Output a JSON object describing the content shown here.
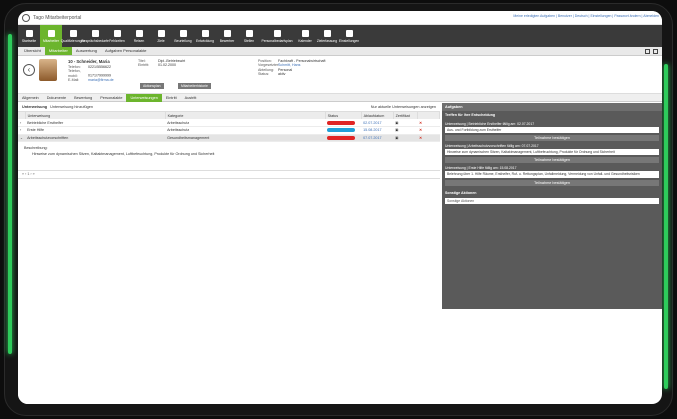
{
  "app": {
    "title": "Tago Mitarbeiterportal"
  },
  "topright": "Meine erledigten Aufgaben | Benutzer | Deutsch | Einstellungen | Passwort ändern | Abmelden",
  "nav": [
    "Startseite",
    "Mitarbeiter",
    "Qualifizierungen",
    "Gesprächsbedarfe",
    "Fehlzeiten",
    "Reisen",
    "Ziele",
    "Beurteilung",
    "Entwicklung",
    "Bewerber",
    "Stellen",
    "Personalbedarfsplan",
    "Kalender",
    "Zielerfassung",
    "Einstellungen"
  ],
  "tabs": [
    "Übersicht",
    "Mitarbeiter",
    "Auswertung",
    "Aufgaben Personalakte"
  ],
  "employee": {
    "name": "10 - Schneider, Maria",
    "col1": [
      [
        "Telefon:",
        "0221/5556622"
      ],
      [
        "Telefon, mobil:",
        "0171/7999999"
      ],
      [
        "E-Mail:",
        "maria@firma.de"
      ]
    ],
    "col2": [
      [
        "Titel:",
        "Dipl.-Betriebswirt"
      ],
      [
        "Eintritt:",
        "01.02.2000"
      ]
    ],
    "col3": [
      [
        "Position:",
        "Fachkraft - Personalwirtschaft"
      ],
      [
        "Vorgesetzter:",
        "Schmitt, Hans"
      ],
      [
        "Abteilung:",
        "Personal"
      ],
      [
        "Status:",
        "aktiv"
      ]
    ],
    "btn1": "Aktionsplan",
    "btn2": "Mitarbeiterhistorie"
  },
  "subtabs": [
    "Allgemein",
    "Dokumente",
    "Bewertung",
    "Personalakte",
    "Unterweisungen",
    "Eintritt",
    "Austritt"
  ],
  "toolbar": {
    "label": "Unterweisung",
    "add": "Unterweisung hinzufügen",
    "checkbox": "Nur aktuelle Unterweisungen anzeigen"
  },
  "columns": [
    "Unterweisung",
    "Kategorie",
    "Status",
    "Ablaufdatum",
    "Zertifikat"
  ],
  "rows": [
    {
      "name": "Betriebliche Ersthelfer",
      "cat": "Arbeitsschutz",
      "color": "#e02424",
      "date": "02.07.2017"
    },
    {
      "name": "Erste Hilfe",
      "cat": "Arbeitsschutz",
      "color": "#1fa0d8",
      "date": "15.08.2017"
    },
    {
      "name": "Arbeitsschutzvorschriften",
      "cat": "Gesundheitsmanagement",
      "color": "#e02424",
      "date": "07.07.2017"
    }
  ],
  "desc": {
    "label": "Beschreibung:",
    "text": "Hinweise zum dynamischen Sitzen, Kaltaktmanagement, Luftbefeuchtung, Produkte für Ordnung und Sicherheit"
  },
  "pager": "«  ‹  1  ›  »",
  "panel": {
    "title": "Aufgaben",
    "section": "Treffen für Ihre Entscheidung",
    "tasks": [
      {
        "h": "Unterweisung | Betriebliche Ersthelfer fällig am: 02.07.2017",
        "box": "Aus- und Fortbildung zum Ersthelfer",
        "btn": "Teilnahme bestätigen"
      },
      {
        "h": "Unterweisung | Arbeitsschutzvorschriften fällig am: 07.07.2017",
        "box": "Hinweise zum dynamischen Sitzen, Kaltaktmanagement, Luftbefeuchtung, Produkte für Ordnung und Sicherheit",
        "btn": "Teilnahme bestätigen"
      },
      {
        "h": "Unterweisung | Erste Hilfe fällig am: 15.08.2017",
        "box": "Belehrung über 1. Hilfe Räume, Ersthelfer, Ruf- u. Rettungsplan, Unfallmeldung, Vermeidung von Unfall- und Gesundheitsrisiken",
        "btn": "Teilnahme bestätigen"
      }
    ],
    "other_label": "Sonstige Aktionen",
    "select_value": "Sonstige Aktionen"
  }
}
